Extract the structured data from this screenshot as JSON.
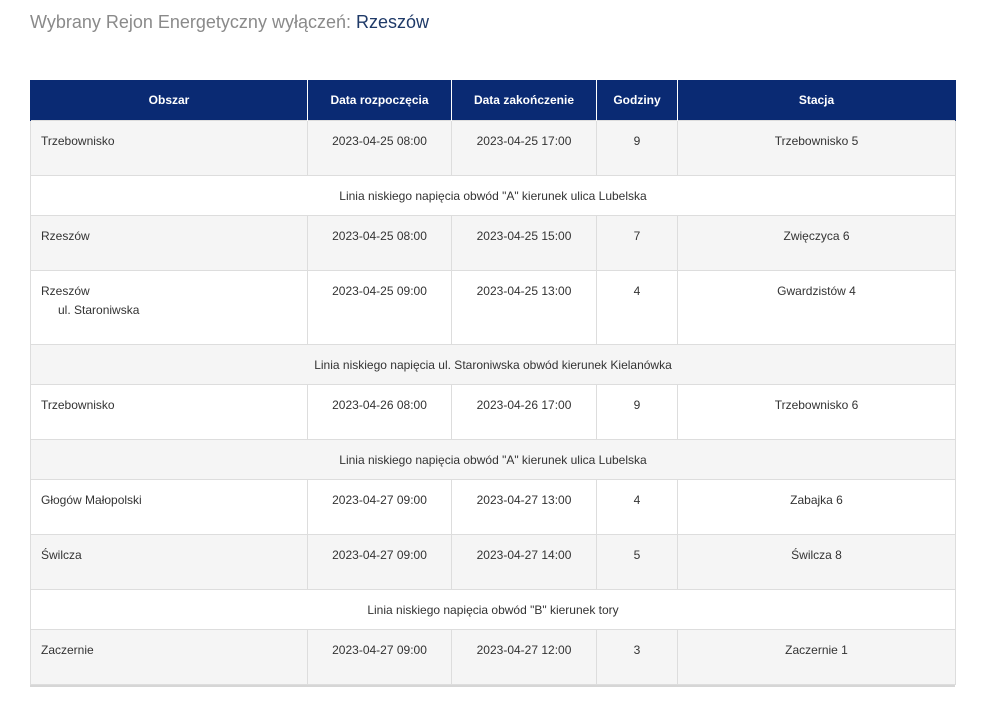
{
  "heading": {
    "prefix": "Wybrany Rejon Energetyczny wyłączeń:",
    "region": "Rzeszów"
  },
  "table": {
    "headers": [
      "Obszar",
      "Data rozpoczęcia",
      "Data zakończenie",
      "Godziny",
      "Stacja"
    ],
    "rows": [
      {
        "area": "Trzebownisko",
        "start": "2023-04-25 08:00",
        "end": "2023-04-25 17:00",
        "hours": "9",
        "station": "Trzebownisko 5"
      },
      {
        "note": "Linia niskiego napięcia obwód \"A\" kierunek ulica Lubelska"
      },
      {
        "area": "Rzeszów",
        "start": "2023-04-25 08:00",
        "end": "2023-04-25 15:00",
        "hours": "7",
        "station": "Zwięczyca 6"
      },
      {
        "area": "Rzeszów",
        "area_sub": "ul. Staroniwska",
        "start": "2023-04-25 09:00",
        "end": "2023-04-25 13:00",
        "hours": "4",
        "station": "Gwardzistów 4"
      },
      {
        "note": "Linia niskiego napięcia ul. Staroniwska obwód kierunek Kielanówka"
      },
      {
        "area": "Trzebownisko",
        "start": "2023-04-26 08:00",
        "end": "2023-04-26 17:00",
        "hours": "9",
        "station": "Trzebownisko 6"
      },
      {
        "note": "Linia niskiego napięcia obwód \"A\" kierunek ulica Lubelska"
      },
      {
        "area": "Głogów Małopolski",
        "start": "2023-04-27 09:00",
        "end": "2023-04-27 13:00",
        "hours": "4",
        "station": "Zabajka 6"
      },
      {
        "area": "Świlcza",
        "start": "2023-04-27 09:00",
        "end": "2023-04-27 14:00",
        "hours": "5",
        "station": "Świlcza 8"
      },
      {
        "note": "Linia niskiego napięcia obwód \"B\" kierunek tory"
      },
      {
        "area": "Zaczernie",
        "start": "2023-04-27 09:00",
        "end": "2023-04-27 12:00",
        "hours": "3",
        "station": "Zaczernie 1"
      }
    ]
  },
  "colors": {
    "header_bg": "#0a2a73",
    "shaded_row": "#f5f5f5",
    "heading_gray": "#8a8a8a",
    "region_blue": "#1f3a68"
  }
}
